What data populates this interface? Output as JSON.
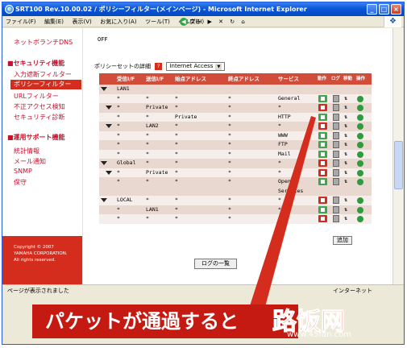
{
  "window": {
    "title": "SRT100 Rev.10.00.02 / ポリシーフィルター(メインページ) - Microsoft Internet Explorer",
    "controls": [
      "_",
      "□",
      "×"
    ]
  },
  "menubar": {
    "items": [
      "ファイル(F)",
      "編集(E)",
      "表示(V)",
      "お気に入り(A)",
      "ツール(T)",
      "ヘルプ(H)"
    ]
  },
  "toolbar": {
    "back_label": "戻る"
  },
  "sidebar": {
    "top_item": "ネットボランチDNS",
    "section1_head": "■セキュリティ機能",
    "section1_items": [
      "入力遮断フィルター",
      "ポリシーフィルター",
      "URLフィルター",
      "不正アクセス検知",
      "セキュリティ診断"
    ],
    "active_index": 1,
    "section2_head": "■運用サポート機能",
    "section2_items": [
      "統計情報",
      "メール通知",
      "SNMP",
      "保守"
    ],
    "copyright": [
      "Copyright © 2007",
      "YAMAHA CORPORATION.",
      "All rights reserved."
    ]
  },
  "content": {
    "off_value": "OFF",
    "set_label": "ポリシーセットの詳細",
    "help_icon": "?",
    "set_select": "Internet Access",
    "headers": [
      "受信I/F",
      "送信I/F",
      "始点アドレス",
      "終点アドレス",
      "サービス",
      "動作",
      "ログ",
      "移動",
      "操作"
    ],
    "rows": [
      {
        "level": 0,
        "tri": true,
        "c1": "LAN1",
        "c2": "",
        "c3": "",
        "c4": "",
        "c5": "",
        "act": "",
        "shade": true
      },
      {
        "level": 1,
        "tri": false,
        "c1": "*",
        "c2": "*",
        "c3": "*",
        "c4": "*",
        "c5": "General",
        "act": "green",
        "shade": false
      },
      {
        "level": 1,
        "tri": true,
        "c1": "*",
        "c2": "Private",
        "c3": "*",
        "c4": "*",
        "c5": "*",
        "act": "red",
        "shade": true
      },
      {
        "level": 2,
        "tri": false,
        "c1": "*",
        "c2": "*",
        "c3": "Private",
        "c4": "*",
        "c5": "HTTP",
        "act": "green",
        "shade": false
      },
      {
        "level": 1,
        "tri": true,
        "c1": "*",
        "c2": "LAN2",
        "c3": "*",
        "c4": "*",
        "c5": "*",
        "act": "red",
        "shade": true
      },
      {
        "level": 2,
        "tri": false,
        "c1": "*",
        "c2": "*",
        "c3": "*",
        "c4": "*",
        "c5": "WWW",
        "act": "green",
        "shade": false
      },
      {
        "level": 2,
        "tri": false,
        "c1": "*",
        "c2": "*",
        "c3": "*",
        "c4": "*",
        "c5": "FTP",
        "act": "green",
        "shade": true
      },
      {
        "level": 2,
        "tri": false,
        "c1": "*",
        "c2": "*",
        "c3": "*",
        "c4": "*",
        "c5": "Mail",
        "act": "green",
        "shade": false
      },
      {
        "level": 0,
        "tri": true,
        "c1": "Global",
        "c2": "*",
        "c3": "*",
        "c4": "*",
        "c5": "*",
        "act": "red",
        "shade": true
      },
      {
        "level": 1,
        "tri": true,
        "c1": "*",
        "c2": "Private",
        "c3": "*",
        "c4": "*",
        "c5": "*",
        "act": "red",
        "shade": false
      },
      {
        "level": 2,
        "tri": false,
        "c1": "*",
        "c2": "*",
        "c3": "*",
        "c4": "*",
        "c5": "Open",
        "act": "green",
        "shade": true
      },
      {
        "level": 2,
        "tri": false,
        "c1": "",
        "c2": "",
        "c3": "",
        "c4": "",
        "c5": "Services",
        "act": "",
        "shade": true
      },
      {
        "level": 0,
        "tri": true,
        "c1": "LOCAL",
        "c2": "*",
        "c3": "*",
        "c4": "*",
        "c5": "*",
        "act": "red",
        "shade": false
      },
      {
        "level": 1,
        "tri": false,
        "c1": "*",
        "c2": "LAN1",
        "c3": "*",
        "c4": "*",
        "c5": "*",
        "act": "green",
        "shade": true
      },
      {
        "level": 1,
        "tri": false,
        "c1": "*",
        "c2": "*",
        "c3": "*",
        "c4": "*",
        "c5": "*",
        "act": "red",
        "shade": false
      }
    ],
    "add_button": "追加",
    "log_button": "ログの一覧"
  },
  "statusbar": {
    "left": "ページが表示されました",
    "right": "インターネット"
  },
  "overlay": {
    "banner": "パケットが通過すると",
    "watermark_title": "路饭网",
    "watermark_url": "www.45fan.com"
  }
}
